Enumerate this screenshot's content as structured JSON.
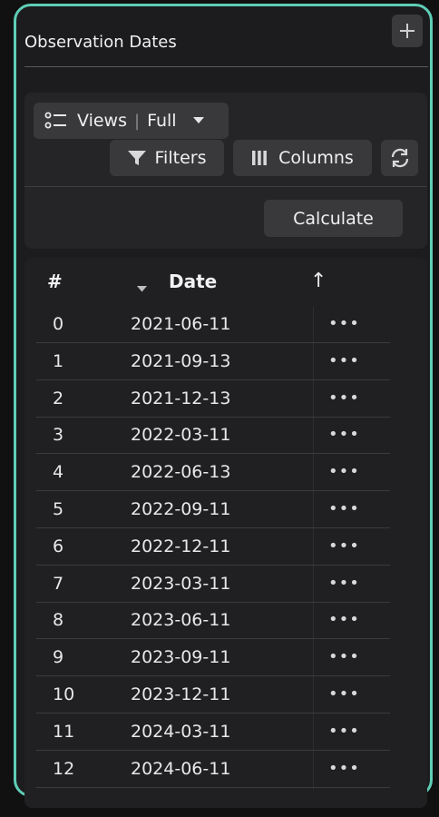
{
  "panel": {
    "title": "Observation Dates"
  },
  "toolbar": {
    "views_label": "Views",
    "views_value": "Full",
    "filters_label": "Filters",
    "columns_label": "Columns",
    "calculate_label": "Calculate"
  },
  "table": {
    "columns": [
      "#",
      "Date"
    ],
    "sort_indicator": "↑",
    "row_action": "•••",
    "rows": [
      {
        "index": "0",
        "date": "2021-06-11"
      },
      {
        "index": "1",
        "date": "2021-09-13"
      },
      {
        "index": "2",
        "date": "2021-12-13"
      },
      {
        "index": "3",
        "date": "2022-03-11"
      },
      {
        "index": "4",
        "date": "2022-06-13"
      },
      {
        "index": "5",
        "date": "2022-09-11"
      },
      {
        "index": "6",
        "date": "2022-12-11"
      },
      {
        "index": "7",
        "date": "2023-03-11"
      },
      {
        "index": "8",
        "date": "2023-06-11"
      },
      {
        "index": "9",
        "date": "2023-09-11"
      },
      {
        "index": "10",
        "date": "2023-12-11"
      },
      {
        "index": "11",
        "date": "2024-03-11"
      },
      {
        "index": "12",
        "date": "2024-06-11"
      }
    ]
  },
  "colors": {
    "accent_border": "#5fcdb6",
    "panel_bg": "#1c1c1e",
    "button_bg": "#39393b"
  }
}
